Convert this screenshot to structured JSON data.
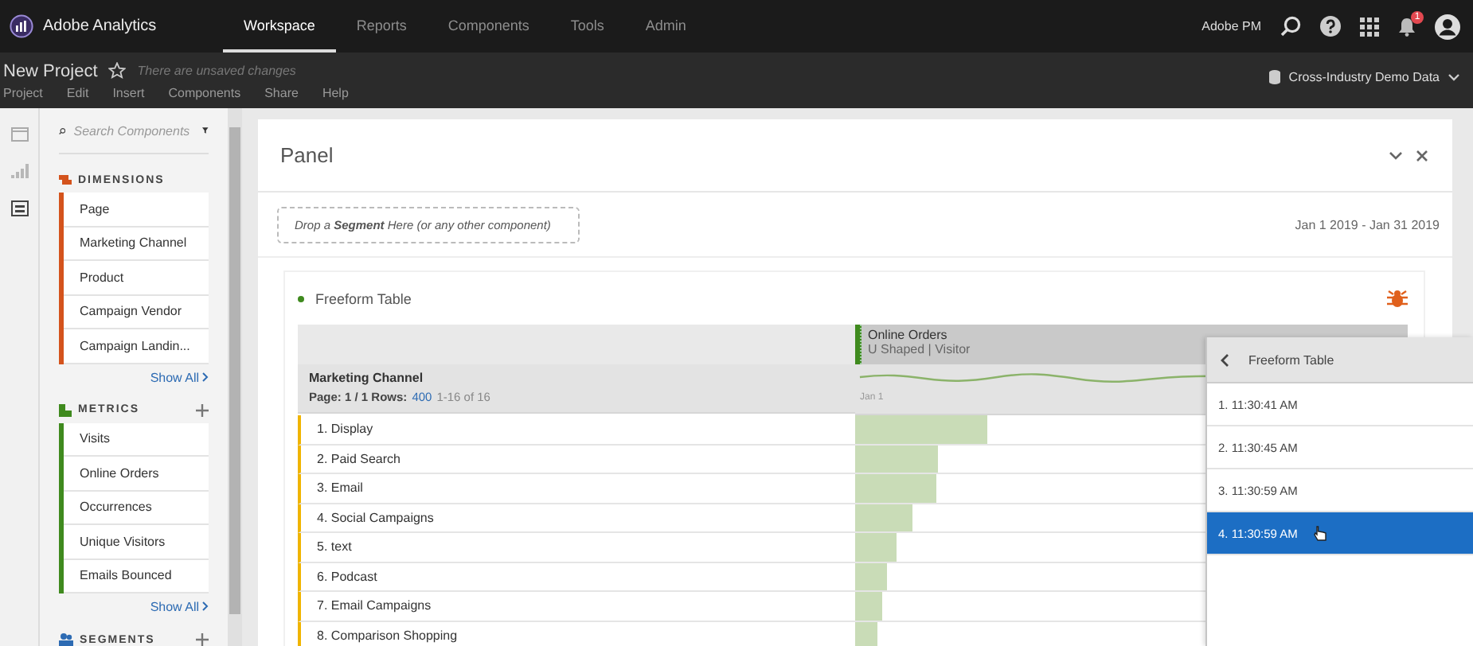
{
  "app": {
    "name": "Adobe Analytics"
  },
  "nav_tabs": [
    {
      "label": "Workspace",
      "selected": true
    },
    {
      "label": "Reports",
      "selected": false
    },
    {
      "label": "Components",
      "selected": false
    },
    {
      "label": "Tools",
      "selected": false
    },
    {
      "label": "Admin",
      "selected": false
    }
  ],
  "account": {
    "org": "Adobe PM",
    "notification_count": "1"
  },
  "project": {
    "title": "New Project",
    "status": "There are unsaved changes",
    "report_suite": "Cross-Industry Demo Data"
  },
  "menu": [
    "Project",
    "Edit",
    "Insert",
    "Components",
    "Share",
    "Help"
  ],
  "rail": [
    {
      "kind": "panels",
      "selected": false
    },
    {
      "kind": "visualizations",
      "selected": false
    },
    {
      "kind": "components",
      "selected": true
    }
  ],
  "components": {
    "search_placeholder": "Search Components",
    "sections": [
      {
        "title": "DIMENSIONS",
        "kind": "dimensions",
        "color": "#d4531c",
        "can_add": false,
        "items": [
          "Page",
          "Marketing Channel",
          "Product",
          "Campaign Vendor",
          "Campaign Landin..."
        ],
        "show_all": "Show All"
      },
      {
        "title": "METRICS",
        "kind": "metrics",
        "color": "#3f8a1e",
        "can_add": true,
        "items": [
          "Visits",
          "Online Orders",
          "Occurrences",
          "Unique Visitors",
          "Emails Bounced"
        ],
        "show_all": "Show All"
      },
      {
        "title": "SEGMENTS",
        "kind": "segments",
        "color": "#2d6bb3",
        "can_add": true
      }
    ]
  },
  "panel": {
    "title": "Panel",
    "drop_zone": "Drop a **Segment** Here (or any other component)",
    "date_range": "Jan 1 2019 - Jan 31 2019"
  },
  "freeform": {
    "title": "Freeform Table",
    "dimension": "Marketing Channel",
    "page_label": "Page: 1 / 1 Rows:",
    "rows_per_page": "400",
    "range": "1-16 of 16",
    "metric": {
      "name": "Online Orders",
      "attribution": "U Shaped | Visitor",
      "date_label": "Jan 1"
    },
    "rows": [
      {
        "label": "1. Display",
        "level": 0.24
      },
      {
        "label": "2. Paid Search",
        "level": 0.15
      },
      {
        "label": "3. Email",
        "level": 0.146
      },
      {
        "label": "4. Social Campaigns",
        "level": 0.103
      },
      {
        "label": "5. text",
        "level": 0.075
      },
      {
        "label": "6. Podcast",
        "level": 0.057
      },
      {
        "label": "7. Email Campaigns",
        "level": 0.049
      },
      {
        "label": "8. Comparison Shopping",
        "level": 0.04
      }
    ]
  },
  "popup": {
    "title": "Freeform Table",
    "items": [
      {
        "label": "1. 11:30:41 AM",
        "selected": false
      },
      {
        "label": "2. 11:30:45 AM",
        "selected": false
      },
      {
        "label": "3. 11:30:59 AM",
        "selected": false
      },
      {
        "label": "4. 11:30:59 AM",
        "selected": true
      }
    ]
  }
}
